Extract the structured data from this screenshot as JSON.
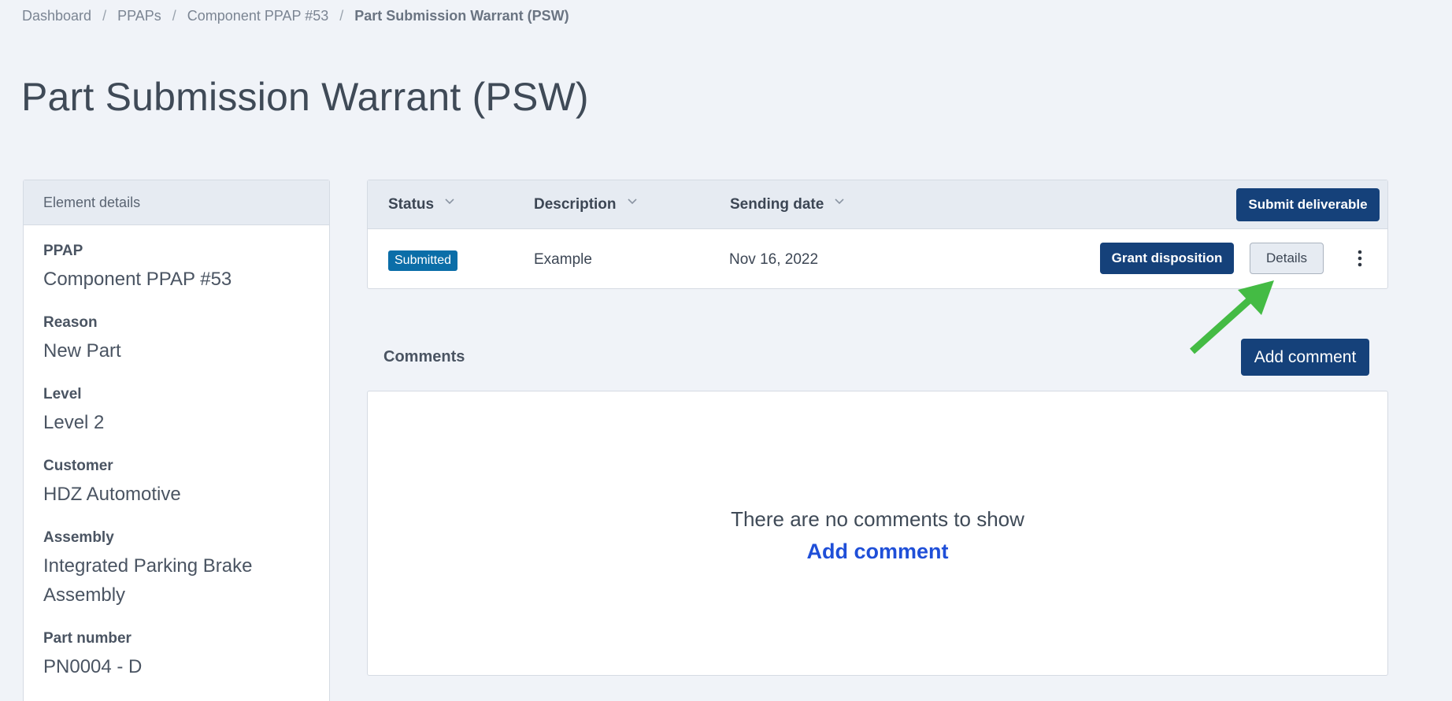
{
  "breadcrumb": {
    "items": [
      "Dashboard",
      "PPAPs",
      "Component PPAP #53"
    ],
    "current": "Part Submission Warrant (PSW)",
    "separator": "/"
  },
  "page": {
    "title": "Part Submission Warrant (PSW)"
  },
  "element_details": {
    "header": "Element details",
    "fields": [
      {
        "label": "PPAP",
        "value": "Component PPAP #53"
      },
      {
        "label": "Reason",
        "value": "New Part"
      },
      {
        "label": "Level",
        "value": "Level 2"
      },
      {
        "label": "Customer",
        "value": "HDZ Automotive"
      },
      {
        "label": "Assembly",
        "value": "Integrated Parking Brake Assembly"
      },
      {
        "label": "Part number",
        "value": "PN0004 - D"
      }
    ]
  },
  "deliverables": {
    "columns": [
      "Status",
      "Description",
      "Sending date"
    ],
    "submit_label": "Submit deliverable",
    "row": {
      "status": "Submitted",
      "description": "Example",
      "sending_date": "Nov 16, 2022",
      "grant_label": "Grant disposition",
      "details_label": "Details"
    }
  },
  "comments": {
    "title": "Comments",
    "add_button_label": "Add comment",
    "empty_text": "There are no comments to show",
    "empty_link": "Add comment"
  },
  "colors": {
    "primary": "#15417a",
    "badge": "#0b6ea8",
    "link": "#1f4fd8",
    "annotation_arrow": "#44bb44"
  }
}
